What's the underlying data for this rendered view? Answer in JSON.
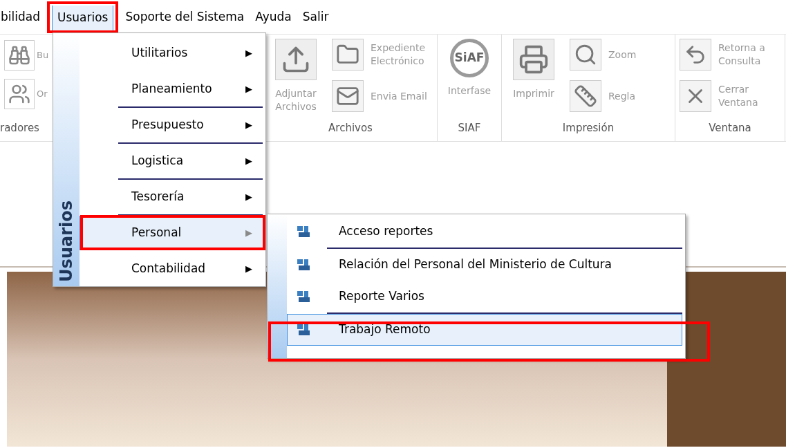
{
  "menu_bar": [
    {
      "label": "bilidad",
      "selected": false
    },
    {
      "label": "Usuarios",
      "selected": true
    },
    {
      "label": "Soporte del Sistema",
      "selected": false
    },
    {
      "label": "Ayuda",
      "selected": false
    },
    {
      "label": "Salir",
      "selected": false
    }
  ],
  "ribbon": {
    "partial_group": {
      "label": "radores",
      "buttons": [
        "Bu",
        "Or"
      ]
    },
    "groups": [
      {
        "label": "Archivos",
        "buttons": [
          {
            "kind": "large",
            "label": "Adjuntar Archivos"
          },
          {
            "kind": "small",
            "label": "Expediente Electrónico"
          },
          {
            "kind": "small",
            "label": "Envia Email"
          }
        ]
      },
      {
        "label": "SIAF",
        "buttons": [
          {
            "kind": "logo",
            "label": "Interfase",
            "icon_text": "SiAF"
          }
        ]
      },
      {
        "label": "Impresión",
        "buttons": [
          {
            "kind": "large",
            "label": "Imprimir"
          },
          {
            "kind": "small",
            "label": "Zoom"
          },
          {
            "kind": "small",
            "label": "Regla"
          }
        ]
      },
      {
        "label": "Ventana",
        "buttons": [
          {
            "kind": "small",
            "label": "Retorna a Consulta"
          },
          {
            "kind": "small",
            "label": "Cerrar Ventana"
          }
        ]
      }
    ]
  },
  "usuarios_menu": {
    "side_label": "Usuarios",
    "items": [
      {
        "label": "Utilitarios",
        "separator": false,
        "selected": false,
        "arrow": "▶"
      },
      {
        "label": "Planeamiento",
        "separator": false,
        "selected": false,
        "arrow": "▶"
      },
      {
        "label": "Presupuesto",
        "separator": true,
        "selected": false,
        "arrow": "▶"
      },
      {
        "label": "Logistica",
        "separator": true,
        "selected": false,
        "arrow": "▶"
      },
      {
        "label": "Tesorería",
        "separator": true,
        "selected": false,
        "arrow": "▶"
      },
      {
        "label": "Personal",
        "separator": true,
        "selected": true,
        "arrow": "▶"
      },
      {
        "label": "Contabilidad",
        "separator": false,
        "selected": false,
        "arrow": "▶"
      }
    ]
  },
  "personal_submenu": {
    "items": [
      {
        "label": "Acceso reportes",
        "separator": false,
        "selected": false
      },
      {
        "label": "Relación del Personal del Ministerio de Cultura",
        "separator": true,
        "selected": false
      },
      {
        "label": "Reporte Varios",
        "separator": false,
        "selected": false
      },
      {
        "label": "Trabajo Remoto",
        "separator": true,
        "selected": true
      }
    ]
  }
}
